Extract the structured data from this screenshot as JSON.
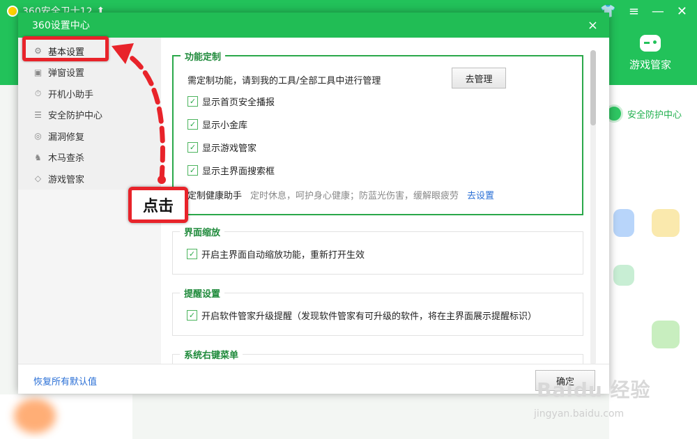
{
  "background": {
    "app_title": "360安全卫士12",
    "game_label": "游戏管家",
    "security_center": "安全防护中心"
  },
  "dialog": {
    "title": "360设置中心",
    "close": "×"
  },
  "sidebar": {
    "items": [
      {
        "label": "基本设置",
        "icon": "gear-icon"
      },
      {
        "label": "弹窗设置",
        "icon": "window-icon"
      },
      {
        "label": "开机小助手",
        "icon": "timer-icon"
      },
      {
        "label": "安全防护中心",
        "icon": "list-icon"
      },
      {
        "label": "漏洞修复",
        "icon": "patch-icon"
      },
      {
        "label": "木马查杀",
        "icon": "horse-icon"
      },
      {
        "label": "游戏管家",
        "icon": "gamepad-icon"
      }
    ]
  },
  "content": {
    "function_custom": {
      "title": "功能定制",
      "desc": "需定制功能，请到我的工具/全部工具中进行管理",
      "manage_button": "去管理",
      "options": [
        "显示首页安全播报",
        "显示小金库",
        "显示游戏管家",
        "显示主界面搜索框"
      ],
      "health_label": "定制健康助手",
      "health_desc": "定时休息，呵护身心健康；防蓝光伤害，缓解眼疲劳",
      "health_link": "去设置"
    },
    "zoom": {
      "title": "界面缩放",
      "option": "开启主界面自动缩放功能，重新打开生效"
    },
    "reminder": {
      "title": "提醒设置",
      "option": "开启软件管家升级提醒（发现软件管家有可升级的软件，将在主界面展示提醒标识）"
    },
    "context_menu": {
      "title": "系统右键菜单"
    }
  },
  "footer": {
    "restore": "恢复所有默认值",
    "ok": "确定"
  },
  "annotation": {
    "callout": "点击"
  },
  "watermark": {
    "brand": "Baidu 经验",
    "url": "jingyan.baidu.com"
  }
}
